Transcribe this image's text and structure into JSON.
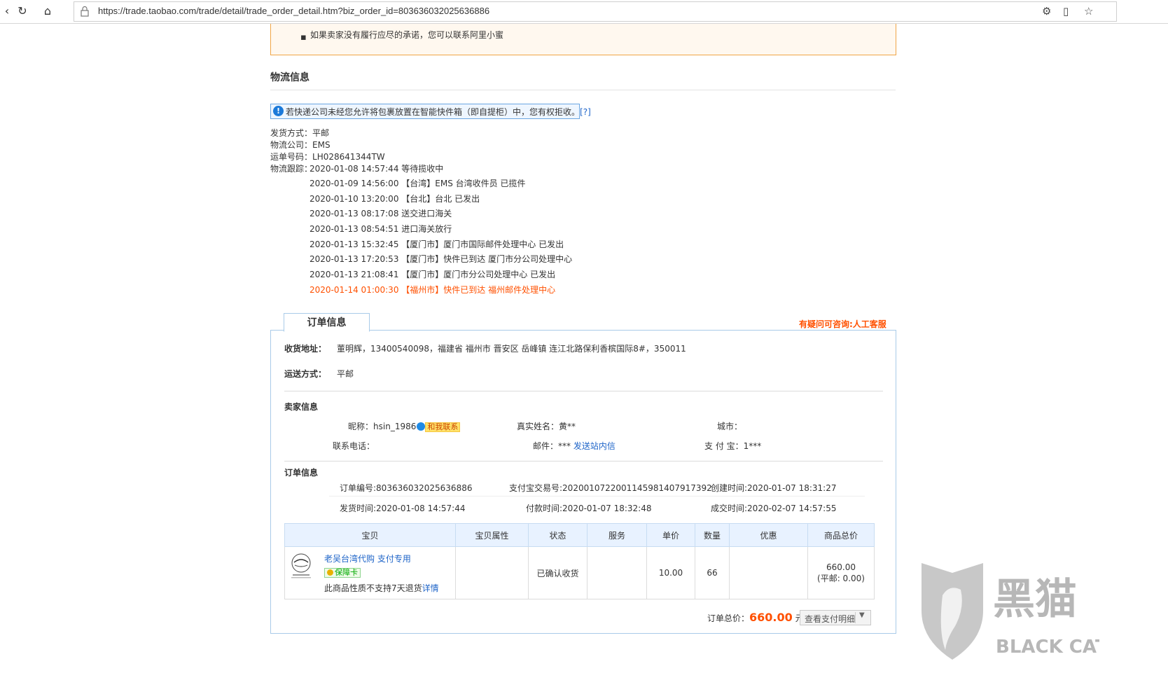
{
  "browser": {
    "url": "https://trade.taobao.com/trade/detail/trade_order_detail.htm?biz_order_id=803636032025636886"
  },
  "notice": {
    "text": "如果卖家没有履行应尽的承诺，您可以联系阿里小蜜"
  },
  "logistics": {
    "section_title": "物流信息",
    "tip_text": "若快递公司未经您允许将包裹放置在智能快件箱（即自提柜）中，您有权拒收。",
    "tip_link": "[?]",
    "ship_method_label": "发货方式：",
    "ship_method": "平邮",
    "company_label": "物流公司：",
    "company": "EMS",
    "tracking_no_label": "运单号码：",
    "tracking_no": "LH028641344TW",
    "trace_label": "物流跟踪：",
    "trace": [
      "2020-01-08 14:57:44 等待揽收中",
      "2020-01-09 14:56:00 【台湾】EMS 台湾收件员 已揽件",
      "2020-01-10 13:20:00 【台北】台北 已发出",
      "2020-01-13 08:17:08 送交进口海关",
      "2020-01-13 08:54:51 进口海关放行",
      "2020-01-13 15:32:45 【厦门市】厦门市国际邮件处理中心 已发出",
      "2020-01-13 17:20:53 【厦门市】快件已到达 厦门市分公司处理中心",
      "2020-01-13 21:08:41 【厦门市】厦门市分公司处理中心 已发出",
      "2020-01-14 01:00:30 【福州市】快件已到达 福州邮件处理中心"
    ]
  },
  "order": {
    "tab_label": "订单信息",
    "help_text": "有疑问可咨询:人工客服",
    "address_label": "收货地址：",
    "address": "董明辉，13400540098，福建省 福州市 晋安区 岳峰镇 连江北路保利香槟国际8#，350011",
    "shipping_label": "运送方式：",
    "shipping": "平邮",
    "seller_title": "卖家信息",
    "nick_label": "昵称：",
    "nick": "hsin_1986",
    "contact_tag": "和我联系",
    "realname_label": "真实姓名：",
    "realname": "黄**",
    "city_label": "城市：",
    "city": "",
    "phone_label": "联系电话：",
    "phone": "",
    "mail_label": "邮件：",
    "mail": "***",
    "mail_link": "发送站内信",
    "alipay_label": "支 付 宝：",
    "alipay": "1***",
    "order_title": "订单信息",
    "order_no": "订单编号:803636032025636886",
    "alipay_no": "支付宝交易号:2020010722001145981407917392",
    "created": "创建时间:2020-01-07 18:31:27",
    "shipped": "发货时间:2020-01-08 14:57:44",
    "paid": "付款时间:2020-01-07 18:32:48",
    "closed": "成交时间:2020-02-07 14:57:55",
    "table": {
      "headers": [
        "宝贝",
        "宝贝属性",
        "状态",
        "服务",
        "单价",
        "数量",
        "优惠",
        "商品总价"
      ],
      "item": {
        "name": "老吴台湾代购 支付专用",
        "badge": "保障卡",
        "note": "此商品性质不支持7天退货",
        "note_link": "详情",
        "attr": "",
        "status": "已确认收货",
        "service": "",
        "price": "10.00",
        "qty": "66",
        "discount": "",
        "total": "660.00",
        "total_note": "(平邮: 0.00)"
      }
    },
    "total_label": "订单总价：",
    "total_amount": "660.00",
    "total_unit": "元",
    "pay_detail_button": "查看支付明细"
  },
  "watermark": {
    "cn": "黑猫",
    "en": "BLACK CAT"
  }
}
